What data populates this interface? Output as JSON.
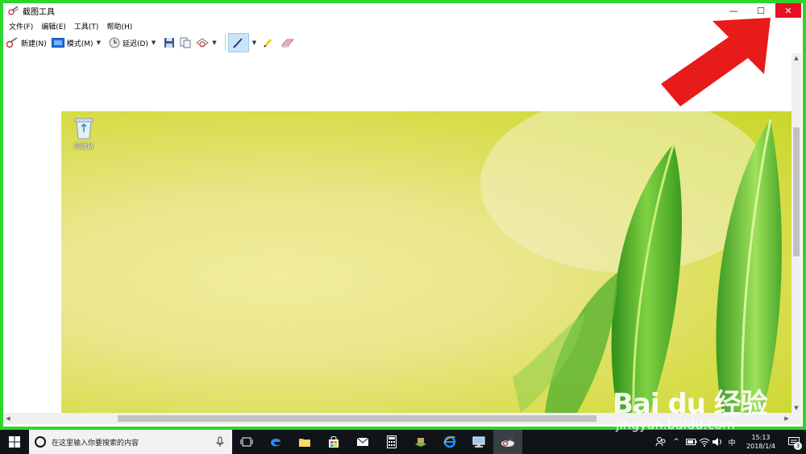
{
  "window": {
    "title": "截图工具",
    "minimize_label": "—",
    "maximize_label": "☐",
    "close_label": "✕"
  },
  "menu": {
    "items": [
      {
        "label": "文件(F)"
      },
      {
        "label": "编辑(E)"
      },
      {
        "label": "工具(T)"
      },
      {
        "label": "帮助(H)"
      }
    ]
  },
  "toolbar": {
    "new_label": "新建(N)",
    "mode_label": "模式(M)",
    "delay_label": "延迟(D)"
  },
  "desktop": {
    "recycle_bin_label": "回收站"
  },
  "taskbar": {
    "search_placeholder": "在这里输入你要搜索的内容",
    "ime_label": "中",
    "time": "15:13",
    "date": "2018/1/4",
    "notification_count": "3"
  },
  "watermark": {
    "brand": "Bai du 经验",
    "url": "jingyan.baidu.com"
  },
  "colors": {
    "highlight_frame": "#2fd42f",
    "close_button": "#e81123",
    "annotation_arrow": "#e81b1b",
    "taskbar": "#101418"
  }
}
